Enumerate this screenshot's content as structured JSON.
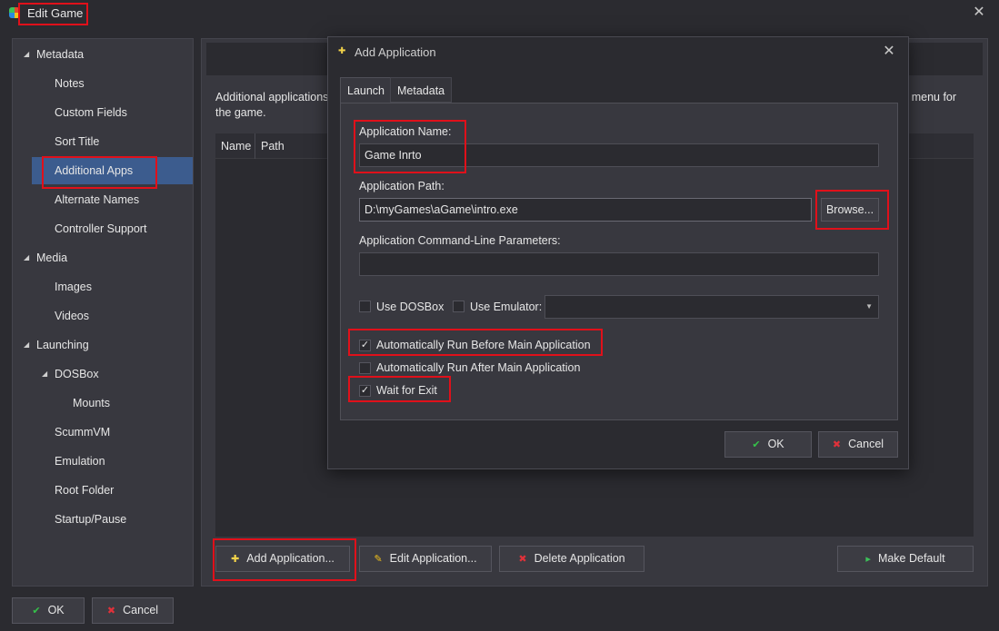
{
  "window": {
    "title": "Edit Game",
    "close_glyph": "✕"
  },
  "sidebar": {
    "items": [
      {
        "label": "Metadata",
        "expander": "◢"
      },
      {
        "label": "Notes"
      },
      {
        "label": "Custom Fields"
      },
      {
        "label": "Sort Title"
      },
      {
        "label": "Additional Apps",
        "selected": true
      },
      {
        "label": "Alternate Names"
      },
      {
        "label": "Controller Support"
      },
      {
        "label": "Media",
        "expander": "◢"
      },
      {
        "label": "Images"
      },
      {
        "label": "Videos"
      },
      {
        "label": "Launching",
        "expander": "◢"
      },
      {
        "label": "DOSBox",
        "expander": "◢"
      },
      {
        "label": "Mounts"
      },
      {
        "label": "ScummVM"
      },
      {
        "label": "Emulation"
      },
      {
        "label": "Root Folder"
      },
      {
        "label": "Startup/Pause"
      }
    ]
  },
  "main": {
    "description_start": "Additional applications",
    "description_end": "the game.",
    "description_right": "k menu for",
    "columns": [
      "Name",
      "Path"
    ],
    "buttons": {
      "add": "Add Application...",
      "edit": "Edit Application...",
      "delete": "Delete Application",
      "make_default": "Make Default"
    }
  },
  "footer": {
    "ok": "OK",
    "cancel": "Cancel"
  },
  "dialog": {
    "title": "Add Application",
    "close_glyph": "✕",
    "tabs": [
      "Launch",
      "Metadata"
    ],
    "active_tab": "Launch",
    "fields": {
      "app_name_label": "Application Name:",
      "app_name_value": "Game Inrto",
      "app_path_label": "Application Path:",
      "app_path_value": "D:\\myGames\\aGame\\intro.exe",
      "browse": "Browse...",
      "cmdline_label": "Application Command-Line Parameters:",
      "cmdline_value": ""
    },
    "options": {
      "use_dosbox": {
        "label": "Use DOSBox",
        "checked": false
      },
      "use_emulator": {
        "label": "Use Emulator:",
        "checked": false
      },
      "emulator_selected": "",
      "run_before": {
        "label": "Automatically Run Before Main Application",
        "checked": true
      },
      "run_after": {
        "label": "Automatically Run After Main Application",
        "checked": false
      },
      "wait_for_exit": {
        "label": "Wait for Exit",
        "checked": true
      }
    },
    "ok": "OK",
    "cancel": "Cancel",
    "check_glyph": "✓"
  },
  "colors": {
    "accent_selected": "#3c5c8e",
    "highlight_box": "#e0101a",
    "ok_icon": "#35c24a",
    "cancel_icon": "#e0313a",
    "add_icon": "#f3d34a",
    "edit_icon": "#f3c21b",
    "make_default_icon": "#3cc15a"
  },
  "icons": {
    "app": "launchbox-app-icon",
    "add": "plus-star-icon",
    "edit": "pencil-icon",
    "delete": "red-x-icon",
    "make_default": "green-arrow-icon",
    "ok": "check-icon",
    "cancel": "red-x-icon"
  }
}
